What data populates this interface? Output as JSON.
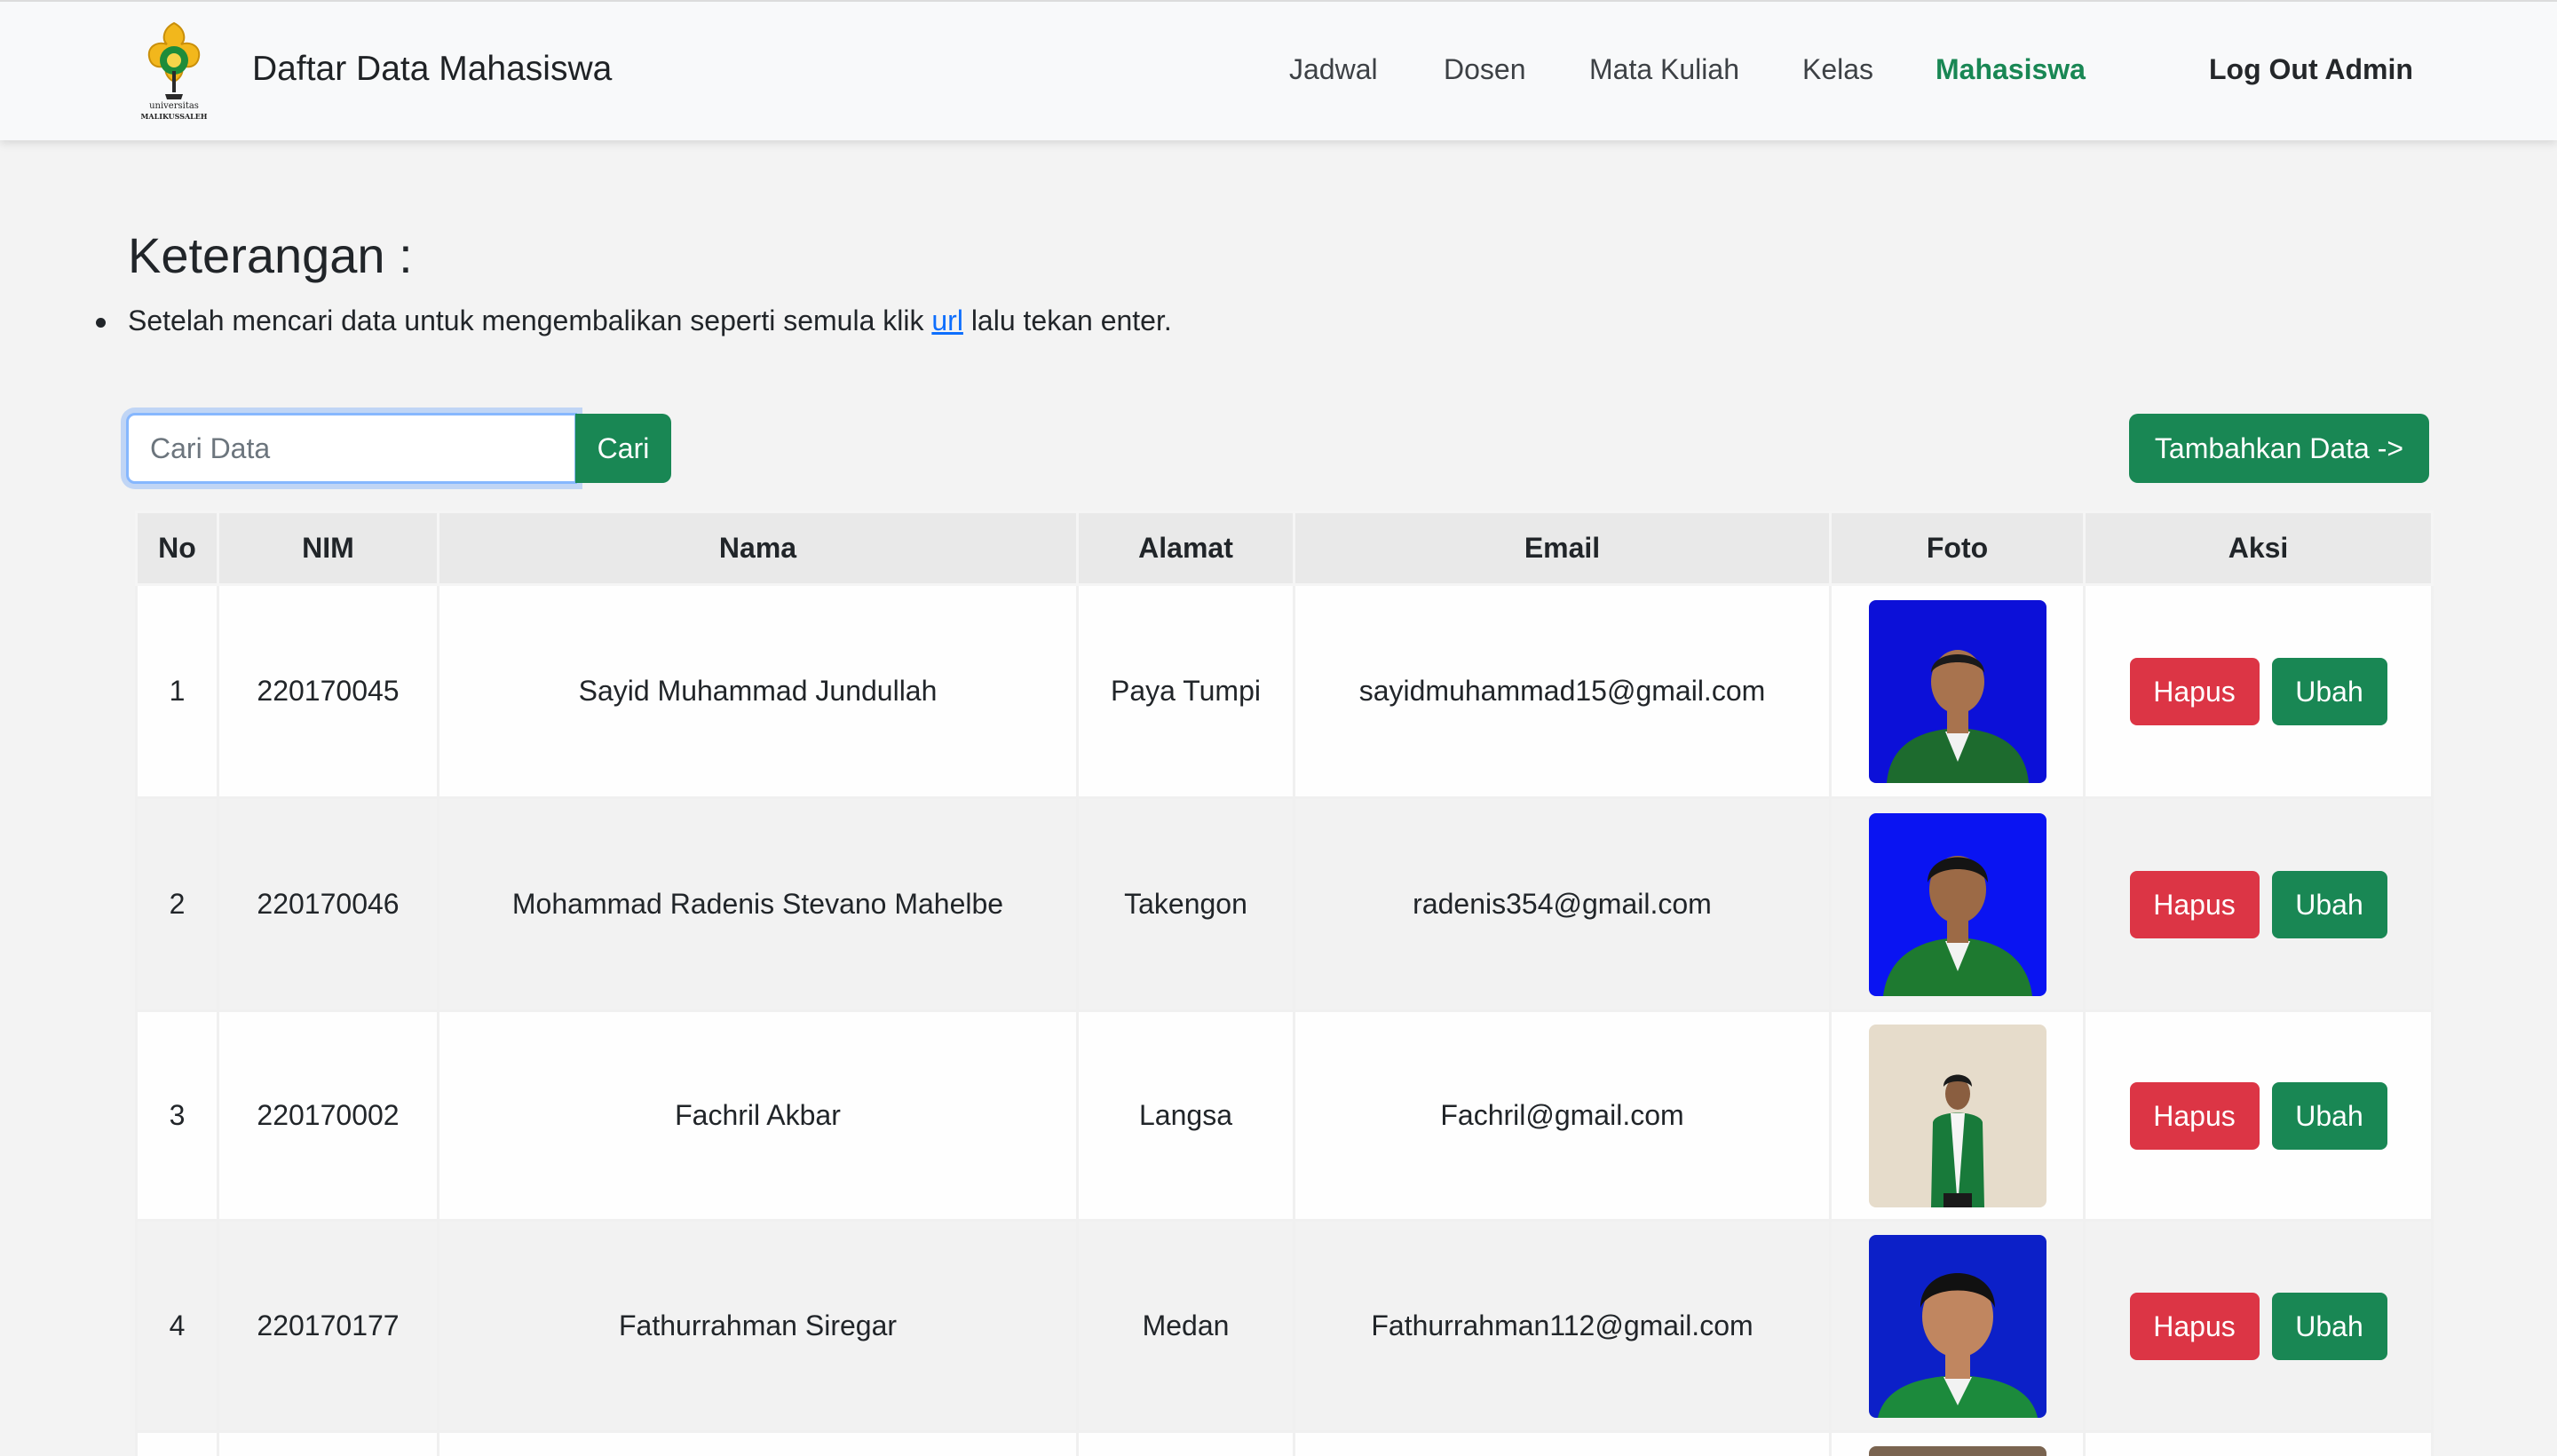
{
  "brand": {
    "title": "Daftar Data Mahasiswa",
    "logo_text_line1": "universitas",
    "logo_text_line2": "MALIKUSSALEH"
  },
  "nav": {
    "items": [
      {
        "label": "Jadwal",
        "active": false
      },
      {
        "label": "Dosen",
        "active": false
      },
      {
        "label": "Mata Kuliah",
        "active": false
      },
      {
        "label": "Kelas",
        "active": false
      },
      {
        "label": "Mahasiswa",
        "active": true
      }
    ],
    "logout_label": "Log Out Admin"
  },
  "info": {
    "heading": "Keterangan :",
    "note_before": "Setelah mencari data untuk mengembalikan seperti semula klik ",
    "note_link": "url",
    "note_after": " lalu tekan enter."
  },
  "search": {
    "placeholder": "Cari Data",
    "value": "",
    "button_label": "Cari"
  },
  "add_button_label": "Tambahkan Data ->",
  "table": {
    "headers": [
      "No",
      "NIM",
      "Nama",
      "Alamat",
      "Email",
      "Foto",
      "Aksi"
    ],
    "rows": [
      {
        "no": "1",
        "nim": "220170045",
        "nama": "Sayid Muhammad Jundullah",
        "alamat": "Paya Tumpi",
        "email": "sayidmuhammad15@gmail.com",
        "photo_bg": "#0c10d8"
      },
      {
        "no": "2",
        "nim": "220170046",
        "nama": "Mohammad Radenis Stevano Mahelbe",
        "alamat": "Takengon",
        "email": "radenis354@gmail.com",
        "photo_bg": "#0a14f2"
      },
      {
        "no": "3",
        "nim": "220170002",
        "nama": "Fachril Akbar",
        "alamat": "Langsa",
        "email": "Fachril@gmail.com",
        "photo_bg": "#e6dccb"
      },
      {
        "no": "4",
        "nim": "220170177",
        "nama": "Fathurrahman Siregar",
        "alamat": "Medan",
        "email": "Fathurrahman112@gmail.com",
        "photo_bg": "#0c20c8"
      }
    ],
    "delete_label": "Hapus",
    "edit_label": "Ubah"
  },
  "colors": {
    "accent": "#198754",
    "danger": "#dc3545",
    "link": "#0d6efd"
  }
}
